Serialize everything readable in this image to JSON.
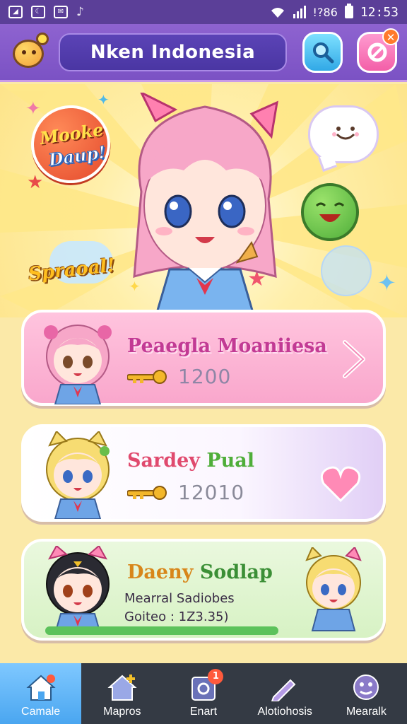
{
  "status_bar": {
    "icons": [
      "notification-icon",
      "moon-icon",
      "mail-icon",
      "music-icon",
      "wifi-icon",
      "signal-icon",
      "battery-icon"
    ],
    "battery_text": "!?86",
    "clock": "12:53"
  },
  "header": {
    "title": "Nken Indonesia"
  },
  "hero": {
    "sticker_line1": "Mooke",
    "sticker_line2": "Daup!",
    "special_text": "Spraoal!"
  },
  "cards": [
    {
      "name": "Peaegla Moaniiesa",
      "score": "1200",
      "accent": "#c23a94"
    },
    {
      "name_part1": "Sardey",
      "name_part2": "Pual",
      "score": "12010"
    },
    {
      "name_part1": "Daeny",
      "name_part2": "Sodlap",
      "sub1": "Mearral Sadiobes",
      "sub2": "Goiteo : 1Z3.35)"
    }
  ],
  "nav": {
    "items": [
      {
        "label": "Camale",
        "icon": "home-icon",
        "active": true
      },
      {
        "label": "Mapros",
        "icon": "house-plus-icon",
        "active": false
      },
      {
        "label": "Enart",
        "icon": "quest-icon",
        "badge": "1",
        "active": false
      },
      {
        "label": "Alotiohosis",
        "icon": "pencil-icon",
        "active": false
      },
      {
        "label": "Mearalk",
        "icon": "face-icon",
        "active": false
      }
    ]
  },
  "colors": {
    "header": "#7b52c4",
    "nav_bg": "#343a44",
    "nav_active": "#4aa6f0",
    "card1": "#f9a7cc",
    "card3": "#d7f2c4"
  }
}
